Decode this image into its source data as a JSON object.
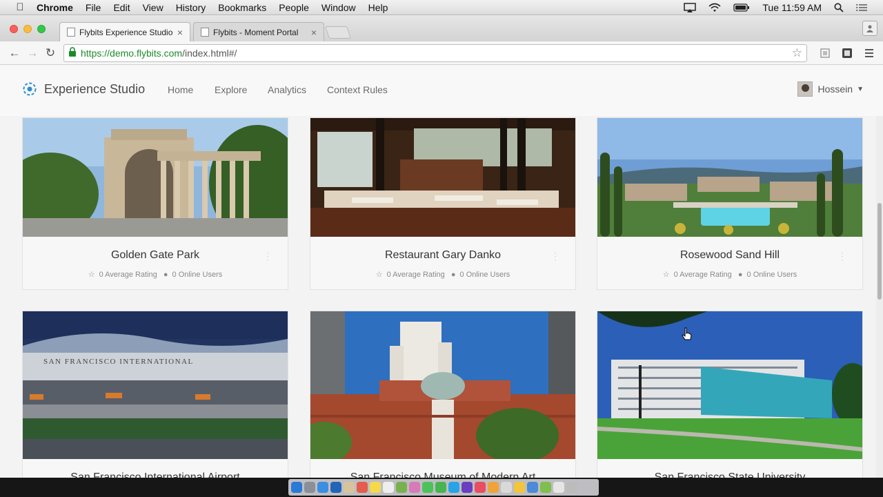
{
  "menubar": {
    "app": "Chrome",
    "items": [
      "File",
      "Edit",
      "View",
      "History",
      "Bookmarks",
      "People",
      "Window",
      "Help"
    ],
    "clock": "Tue 11:59 AM"
  },
  "tabs": [
    {
      "label": "Flybits Experience Studio",
      "active": true
    },
    {
      "label": "Flybits - Moment Portal",
      "active": false
    }
  ],
  "address": {
    "scheme": "https://",
    "host": "demo.flybits.com",
    "path": "/index.html#/"
  },
  "app": {
    "brand": "Experience Studio",
    "nav": [
      "Home",
      "Explore",
      "Analytics",
      "Context Rules"
    ],
    "user": "Hossein"
  },
  "cards": [
    {
      "title": "Golden Gate Park",
      "rating": "0 Average Rating",
      "users": "0 Online Users"
    },
    {
      "title": "Restaurant Gary Danko",
      "rating": "0 Average Rating",
      "users": "0 Online Users"
    },
    {
      "title": "Rosewood Sand Hill",
      "rating": "0 Average Rating",
      "users": "0 Online Users"
    },
    {
      "title": "San Francisco International Airport"
    },
    {
      "title": "San Francisco Museum of Modern Art"
    },
    {
      "title": "San Francisco State University"
    }
  ],
  "photo_text": {
    "airport_sign": "SAN FRANCISCO INTERNATIONAL"
  },
  "colors": {
    "url_green": "#1c8a2b",
    "brand_blue": "#2d8fd1",
    "page_bg": "#f3f3f3"
  }
}
